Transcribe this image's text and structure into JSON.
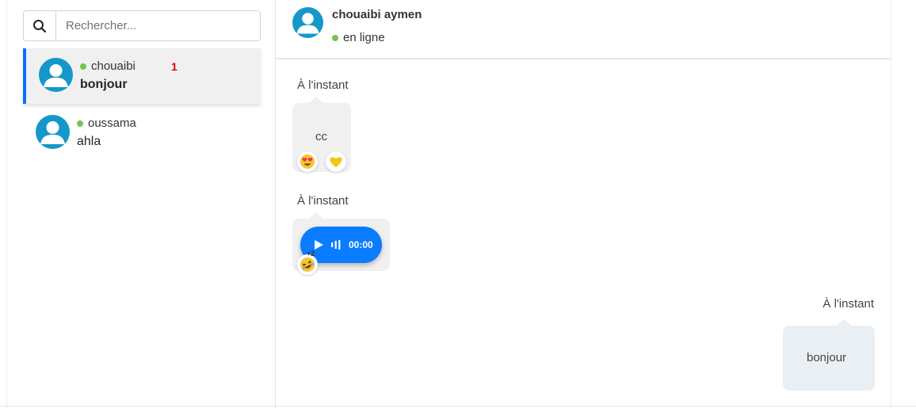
{
  "search": {
    "placeholder": "Rechercher..."
  },
  "contacts": [
    {
      "name": "chouaibi",
      "last_message": "bonjour",
      "unread": "1",
      "online": true,
      "active": true
    },
    {
      "name": "oussama",
      "last_message": "ahla",
      "online": true,
      "active": false
    }
  ],
  "chat_header": {
    "name": "chouaibi aymen",
    "status": "en ligne"
  },
  "messages": [
    {
      "direction": "received",
      "timestamp": "À l'instant",
      "text": "cc",
      "reactions": [
        "heart-eyes-emoji-icon",
        "yellow-heart-emoji-icon"
      ]
    },
    {
      "direction": "received",
      "timestamp": "À l'instant",
      "type": "audio",
      "duration": "00:00",
      "reactions": [
        "rofl-emoji-icon"
      ],
      "reaction_count": "+2"
    },
    {
      "direction": "sent",
      "timestamp": "À l'instant",
      "text": "bonjour"
    }
  ],
  "colors": {
    "accent": "#0d6efd",
    "online": "#7bc24b",
    "avatar": "#1597c9",
    "unread_badge": "#e00000",
    "audio_bubble": "#0a7cff"
  }
}
